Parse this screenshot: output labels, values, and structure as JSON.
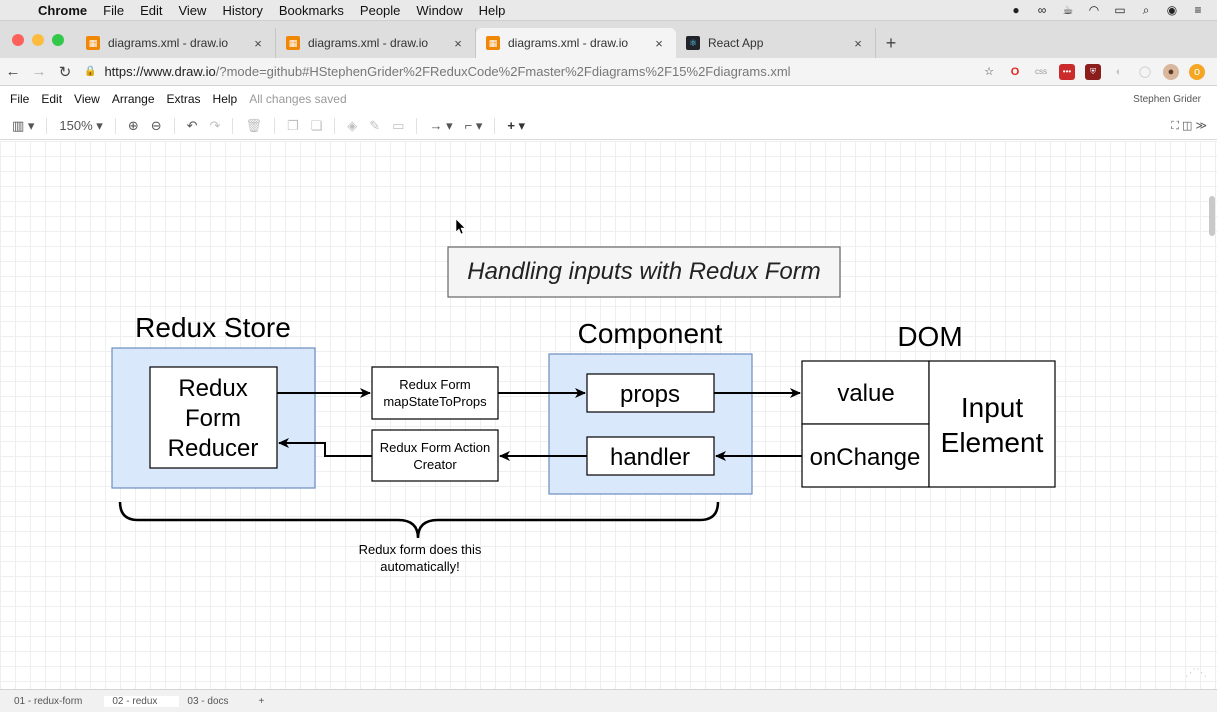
{
  "os_menu": {
    "app": "Chrome",
    "items": [
      "File",
      "Edit",
      "View",
      "History",
      "Bookmarks",
      "People",
      "Window",
      "Help"
    ]
  },
  "tabs": [
    {
      "title": "diagrams.xml - draw.io",
      "favicon": "drawio-icon",
      "active": false
    },
    {
      "title": "diagrams.xml - draw.io",
      "favicon": "drawio-icon",
      "active": false
    },
    {
      "title": "diagrams.xml - draw.io",
      "favicon": "drawio-icon",
      "active": true
    },
    {
      "title": "React App",
      "favicon": "react-icon",
      "active": false
    }
  ],
  "address": {
    "host": "https://www.draw.io",
    "path": "/?mode=github#HStephenGrider%2FReduxCode%2Fmaster%2Fdiagrams%2F15%2Fdiagrams.xml"
  },
  "app_menu": {
    "items": [
      "File",
      "Edit",
      "View",
      "Arrange",
      "Extras",
      "Help"
    ],
    "status": "All changes saved",
    "user": "Stephen Grider"
  },
  "toolbar": {
    "zoom": "150%"
  },
  "diagram": {
    "title": "Handling inputs with Redux Form",
    "redux_store_label": "Redux Store",
    "reducer_lines": [
      "Redux",
      "Form",
      "Reducer"
    ],
    "component_label": "Component",
    "dom_label": "DOM",
    "map_state_lines": [
      "Redux Form",
      "mapStateToProps"
    ],
    "action_creator_lines": [
      "Redux Form Action",
      "Creator"
    ],
    "props": "props",
    "handler": "handler",
    "value": "value",
    "on_change": "onChange",
    "input_element_lines": [
      "Input",
      "Element"
    ],
    "brace_caption_lines": [
      "Redux form does this",
      "automatically!"
    ]
  },
  "page_tabs": [
    "01 - redux-form",
    "02 - redux",
    "03 - docs"
  ],
  "colors": {
    "accent_fill": "#dae8fc",
    "accent_stroke": "#6c8ebf",
    "drawio_orange": "#f08705"
  }
}
